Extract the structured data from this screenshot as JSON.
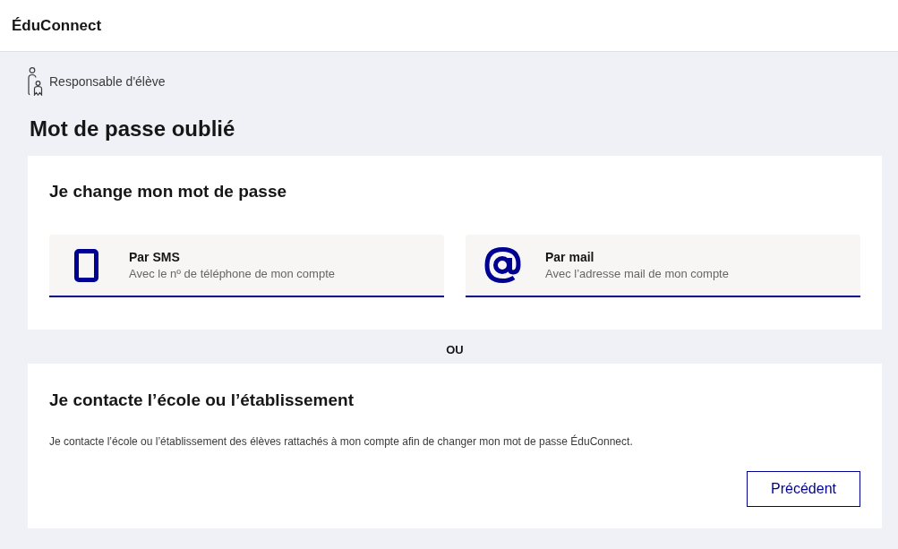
{
  "header": {
    "title": "ÉduConnect"
  },
  "profile": {
    "label": "Responsable d'élève"
  },
  "page_title": "Mot de passe oublié",
  "change_section": {
    "title": "Je change mon mot de passe",
    "options": [
      {
        "kind": "sms",
        "title": "Par SMS",
        "description": "Avec le nº de téléphone de mon compte"
      },
      {
        "kind": "mail",
        "title": "Par mail",
        "description": "Avec l’adresse mail de mon compte"
      }
    ]
  },
  "separator": "OU",
  "contact_section": {
    "title": "Je contacte l’école ou l’établissement",
    "text": "Je contacte l’école ou l’établissement des élèves rattachés à mon compte afin de changer mon mot de passe ÉduConnect.",
    "buttons": [
      "Précédent"
    ]
  }
}
